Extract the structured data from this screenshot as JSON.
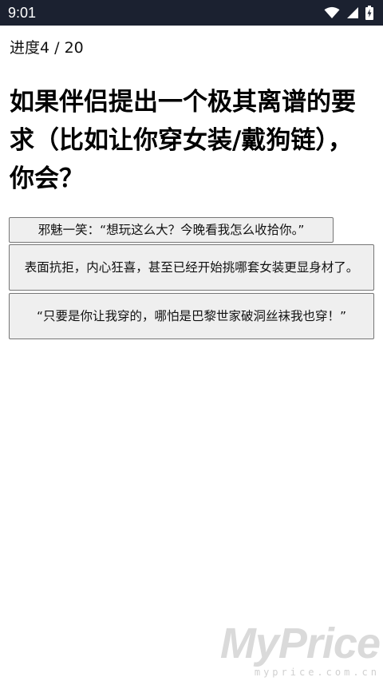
{
  "status_bar": {
    "time": "9:01",
    "icons": [
      "wifi-icon",
      "cellular-signal-icon",
      "battery-charging-icon"
    ],
    "background": "#1b2130"
  },
  "progress_label": "进度4 / 20",
  "question": "如果伴侣提出一个极其离谱的要求（比如让你穿女装/戴狗链），你会？",
  "options": [
    {
      "label": "邪魅一笑：“想玩这么大？今晚看我怎么收拾你。”"
    },
    {
      "label": "表面抗拒，内心狂喜，甚至已经开始挑哪套女装更显身材了。"
    },
    {
      "label": "“只要是你让我穿的，哪怕是巴黎世家破洞丝袜我也穿！”"
    }
  ],
  "watermark": {
    "logo": "MyPrice",
    "url": "myprice.com.cn"
  }
}
